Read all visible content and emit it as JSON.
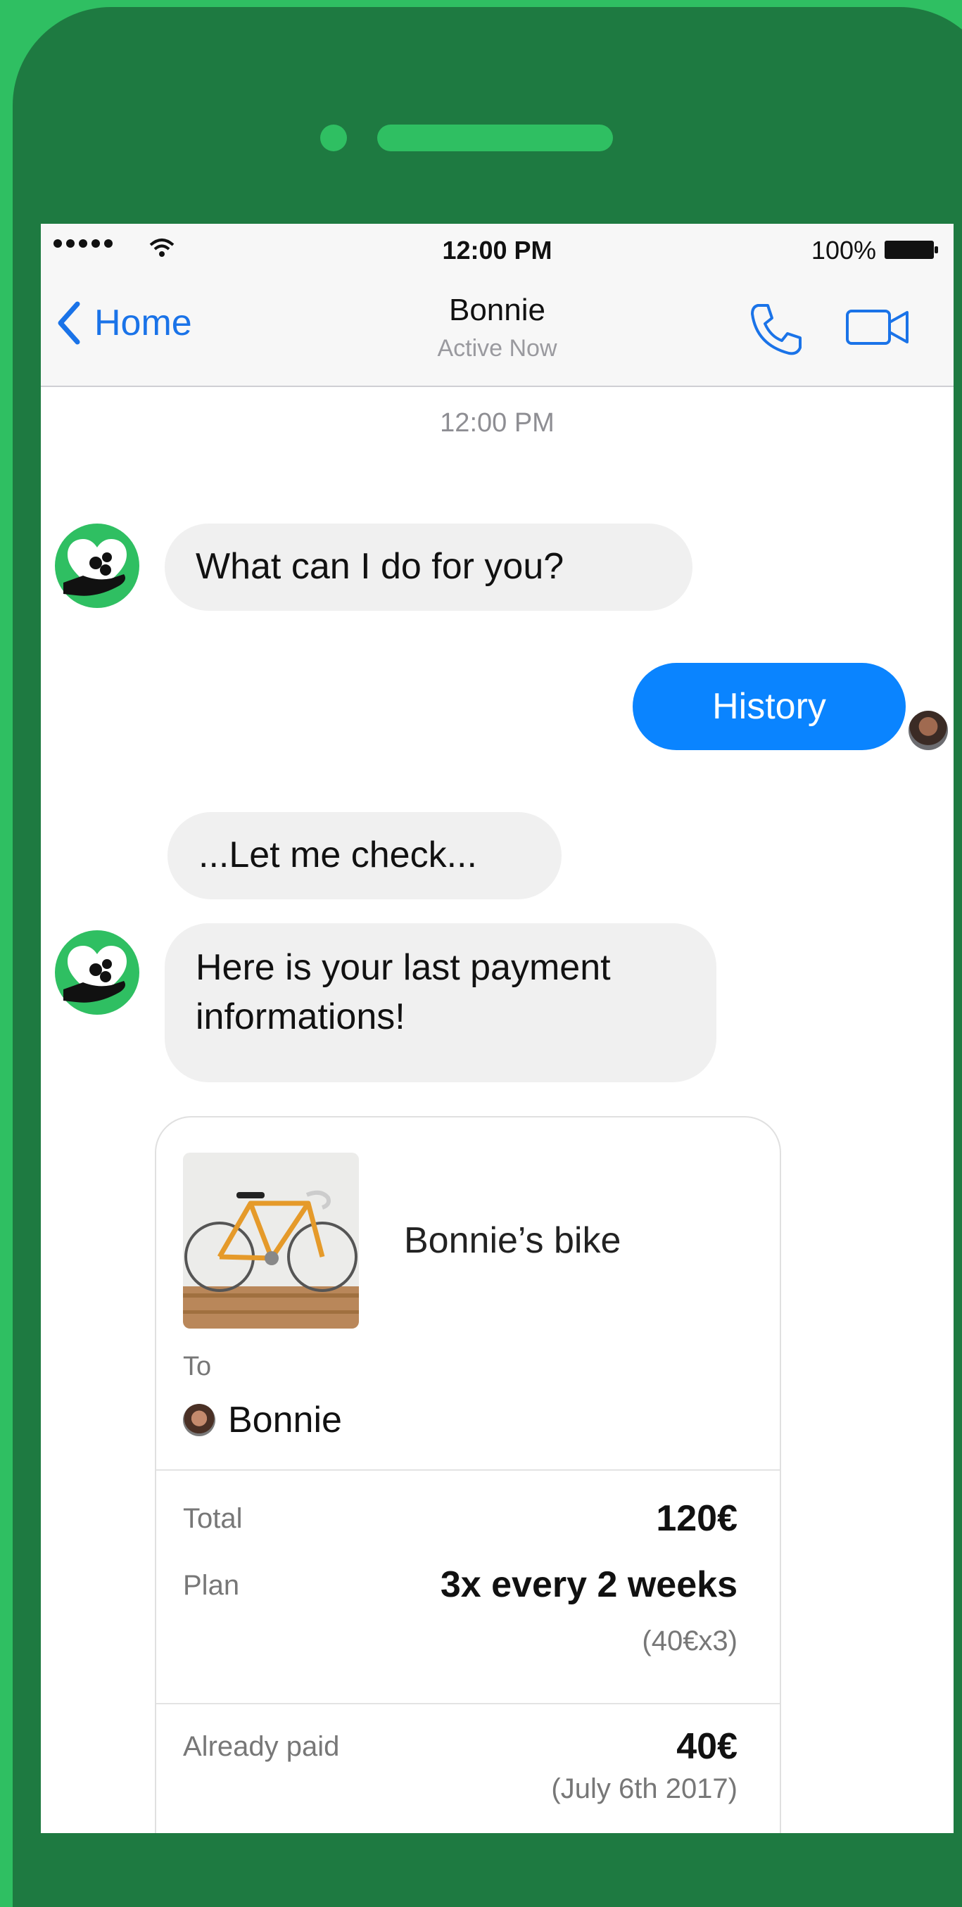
{
  "status_bar": {
    "time": "12:00 PM",
    "battery": "100%"
  },
  "nav": {
    "back_label": "Home",
    "title": "Bonnie",
    "subtitle": "Active Now"
  },
  "chat": {
    "timestamp": "12:00 PM",
    "messages": [
      {
        "from": "bot",
        "text": "What can I do for you?"
      },
      {
        "from": "user",
        "text": "History"
      },
      {
        "from": "bot",
        "text": "...Let me check..."
      },
      {
        "from": "bot",
        "text": "Here is your last payment informations!"
      }
    ]
  },
  "receipt": {
    "product_name": "Bonnie’s bike",
    "to_label": "To",
    "to_name": "Bonnie",
    "total_label": "Total",
    "total_value": "120€",
    "plan_label": "Plan",
    "plan_value": "3x every 2 weeks",
    "plan_note": "(40€x3)",
    "paid_label": "Already paid",
    "paid_value": "40€",
    "paid_note": "(July 6th 2017)"
  },
  "colors": {
    "background_green": "#2fbf62",
    "phone_green": "#1e7a41",
    "accent_blue": "#0a84ff"
  }
}
